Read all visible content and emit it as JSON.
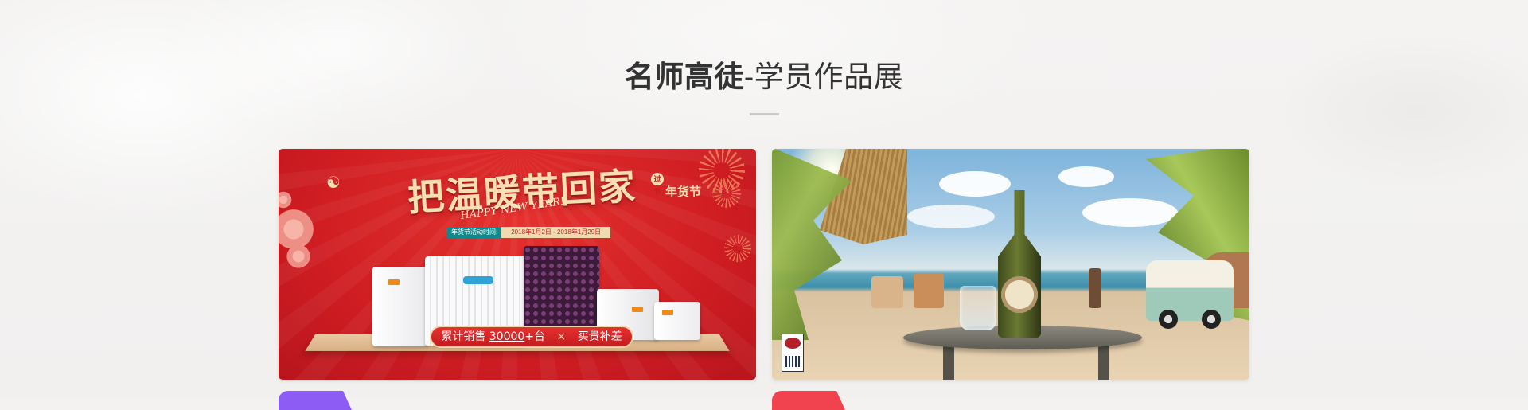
{
  "section": {
    "title_strong": "名师高徒",
    "title_rest": "-学员作品展"
  },
  "works": [
    {
      "headline": "把温暖带回家",
      "subtitle": "HAPPY NEW YEAR!",
      "tag_mini": "过节",
      "tag": "年货节",
      "date_label": "年货节活动时间:",
      "date_value": "2018年1月2日 - 2018年1月29日",
      "pill_prefix": "累计销售",
      "pill_number": "30000",
      "pill_unit": "+台",
      "pill_sep": "×",
      "pill_suffix": "买贵补差",
      "colors": {
        "background": "#cf1d22",
        "gold": "#f7dfb2"
      }
    },
    {
      "brand_icon": "martini-logo-icon",
      "colors": {
        "sky": "#7fb4dc",
        "sand": "#e8d3b3",
        "sea": "#3e8fab"
      }
    }
  ],
  "icons": {
    "cloud": "cloud-ornament-icon",
    "firework": "firework-icon",
    "flower": "flower-icon"
  },
  "colors": {
    "title_text": "#333333",
    "divider": "#c9c9c9",
    "tag_purple": "#8d5cf5",
    "tag_red": "#f0434f"
  }
}
